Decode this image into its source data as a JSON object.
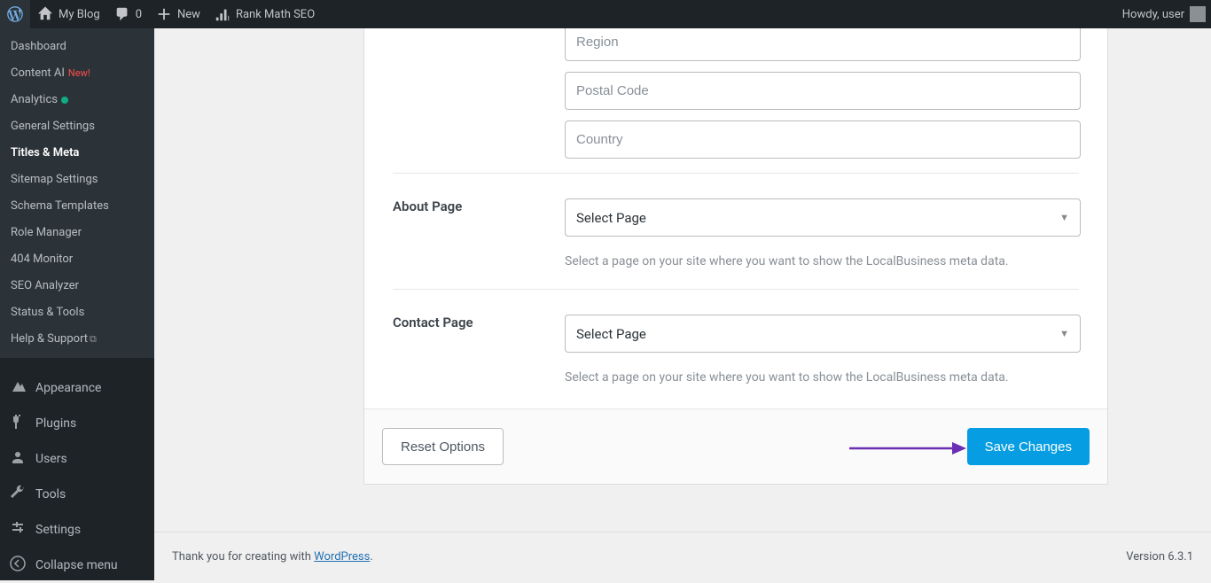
{
  "adminbar": {
    "site_name": "My Blog",
    "comments_count": "0",
    "new_label": "New",
    "rankmath_label": "Rank Math SEO",
    "howdy": "Howdy, user"
  },
  "sidebar": {
    "sub": {
      "dashboard": "Dashboard",
      "content_ai": "Content AI",
      "content_ai_badge": "New!",
      "analytics": "Analytics",
      "general": "General Settings",
      "titles": "Titles & Meta",
      "sitemap": "Sitemap Settings",
      "schema": "Schema Templates",
      "role": "Role Manager",
      "monitor": "404 Monitor",
      "seo_analyzer": "SEO Analyzer",
      "status": "Status & Tools",
      "help": "Help & Support"
    },
    "top": {
      "appearance": "Appearance",
      "plugins": "Plugins",
      "users": "Users",
      "tools": "Tools",
      "settings": "Settings",
      "collapse": "Collapse menu"
    }
  },
  "form": {
    "region_ph": "Region",
    "postal_ph": "Postal Code",
    "country_ph": "Country",
    "about_label": "About Page",
    "contact_label": "Contact Page",
    "select_page": "Select Page",
    "about_desc": "Select a page on your site where you want to show the LocalBusiness meta data.",
    "contact_desc": "Select a page on your site where you want to show the LocalBusiness meta data.",
    "reset": "Reset Options",
    "save": "Save Changes"
  },
  "footer": {
    "thanks": "Thank you for creating with ",
    "wp": "WordPress",
    "dot": ".",
    "version": "Version 6.3.1"
  }
}
